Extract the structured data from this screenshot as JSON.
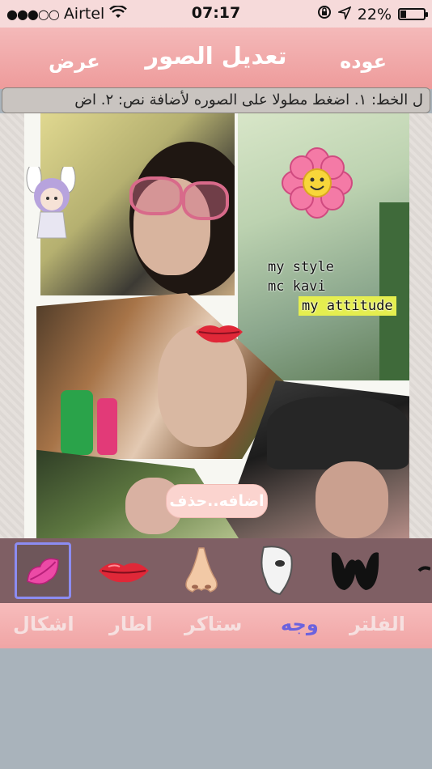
{
  "status_bar": {
    "carrier": "Airtel",
    "signal_dots": "●●●○○",
    "time": "07:17",
    "battery": "22%"
  },
  "nav": {
    "back_label": "عوده",
    "title": "تعديل الصور",
    "show_label": "عرض"
  },
  "instructions": "ل الخط: ١. اضغط مطولا على الصوره لأضافة نص: ٢. اض",
  "collage": {
    "text_sticker": {
      "line1": "my style",
      "line2": "mc kavi",
      "line3": "my attitude"
    },
    "add_delete_label": "اضافه..حذف"
  },
  "sticker_tray": {
    "items": [
      {
        "icon": "pink-kiss-lips-icon",
        "selected": true
      },
      {
        "icon": "red-lips-icon",
        "selected": false
      },
      {
        "icon": "nose-icon",
        "selected": false
      },
      {
        "icon": "phantom-mask-icon",
        "selected": false
      },
      {
        "icon": "mustache-icon",
        "selected": false
      },
      {
        "icon": "partial-icon",
        "selected": false
      }
    ]
  },
  "tabs": [
    {
      "label": "اشكال",
      "active": false
    },
    {
      "label": "اطار",
      "active": false
    },
    {
      "label": "ستاكر",
      "active": false
    },
    {
      "label": "وجه",
      "active": true
    },
    {
      "label": "الفلتر",
      "active": false
    }
  ],
  "colors": {
    "accent": "#6b62de",
    "nav_background": "#f0a5a5",
    "tab_inactive": "#f6e0e0"
  }
}
